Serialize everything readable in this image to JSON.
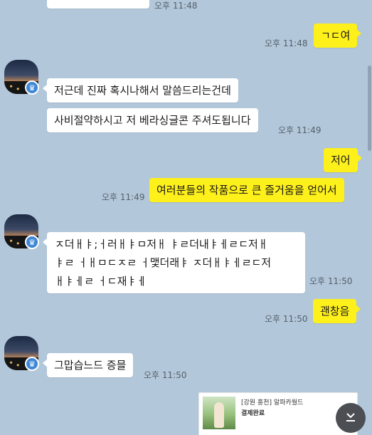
{
  "messages": [
    {
      "text": "",
      "time": "오후 11:48"
    },
    {
      "text": "ㄱㄷ여",
      "time": "오후 11:48"
    },
    {
      "text": "저근데 진짜 혹시나해서 말씀드리는건데",
      "time": ""
    },
    {
      "text": "사비절약하시고 저 베라싱글콘 주셔도됩니다",
      "time": "오후 11:49"
    },
    {
      "text": "저어",
      "time": ""
    },
    {
      "text": "여러분들의 작품으로 큰 즐거움을 얻어서",
      "time": "오후 11:49"
    },
    {
      "line1": "ㅈ더ㅐㅑ;ㅓ러ㅐㅑㅁ저ㅐ ㅑㄹ더내ㅑㅔㄹㄷ저ㅐ",
      "line2": "ㅑㄹ ㅓㅐㅁㄷㅈㄹ ㅓ맻더래ㅑ ㅈ더ㅐㅑㅔㄹㄷ저",
      "line3": "ㅐㅑㅔㄹ ㅓㄷ재ㅑㅔ",
      "time": "오후 11:50"
    },
    {
      "text": "괜창음",
      "time": "오후 11:50"
    },
    {
      "text": "그맙습느드 증믈",
      "time": "오후 11:50"
    }
  ],
  "card": {
    "title": "[강원 홍천] 알파카월드",
    "subtitle": "결제완료"
  },
  "icons": {
    "badge": "crown-badge-icon",
    "scroll_down": "double-chevron-down-icon"
  },
  "colors": {
    "background": "#b2c7da",
    "outgoing_bubble": "#fef01b",
    "incoming_bubble": "#ffffff",
    "badge": "#3f87d6"
  }
}
